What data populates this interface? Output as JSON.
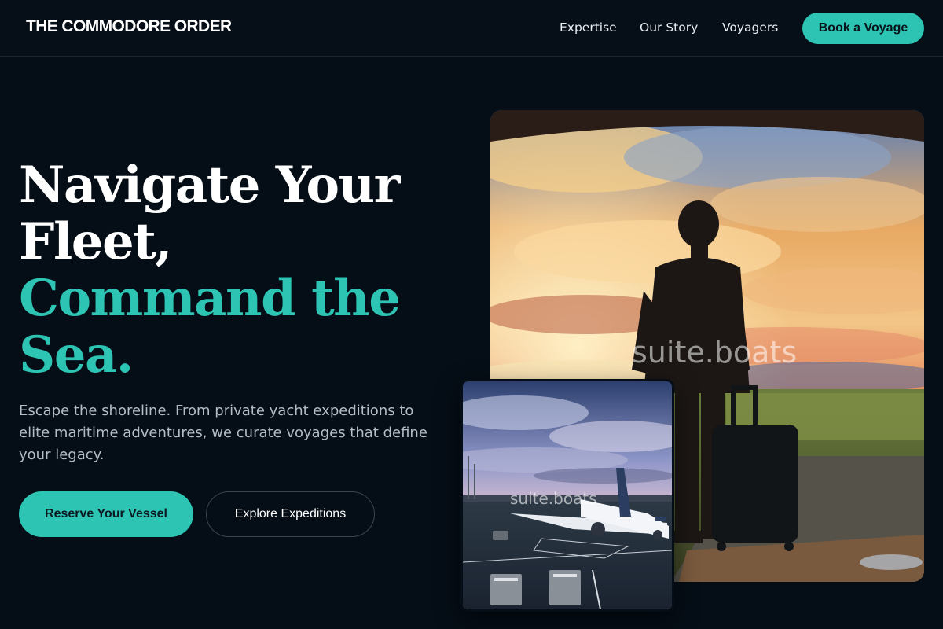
{
  "header": {
    "brand": "THE COMMODORE ORDER",
    "nav": [
      "Expertise",
      "Our Story",
      "Voyagers"
    ],
    "cta": "Book a Voyage"
  },
  "hero": {
    "title_lines": [
      "Navigate Your",
      "Fleet,"
    ],
    "accent_lines": [
      "Command the",
      "Sea."
    ],
    "subtitle": "Escape the shoreline. From private yacht expeditions to elite maritime adventures, we curate voyages that define your legacy.",
    "primary_button": "Reserve Your Vessel",
    "secondary_button": "Explore Expeditions"
  },
  "images": {
    "main_watermark": "suite.boats",
    "inset_watermark": "suite.boats"
  },
  "colors": {
    "background": "#050d16",
    "accent": "#2ec4b3",
    "text": "#ffffff",
    "muted_text": "#b4bcc6"
  }
}
